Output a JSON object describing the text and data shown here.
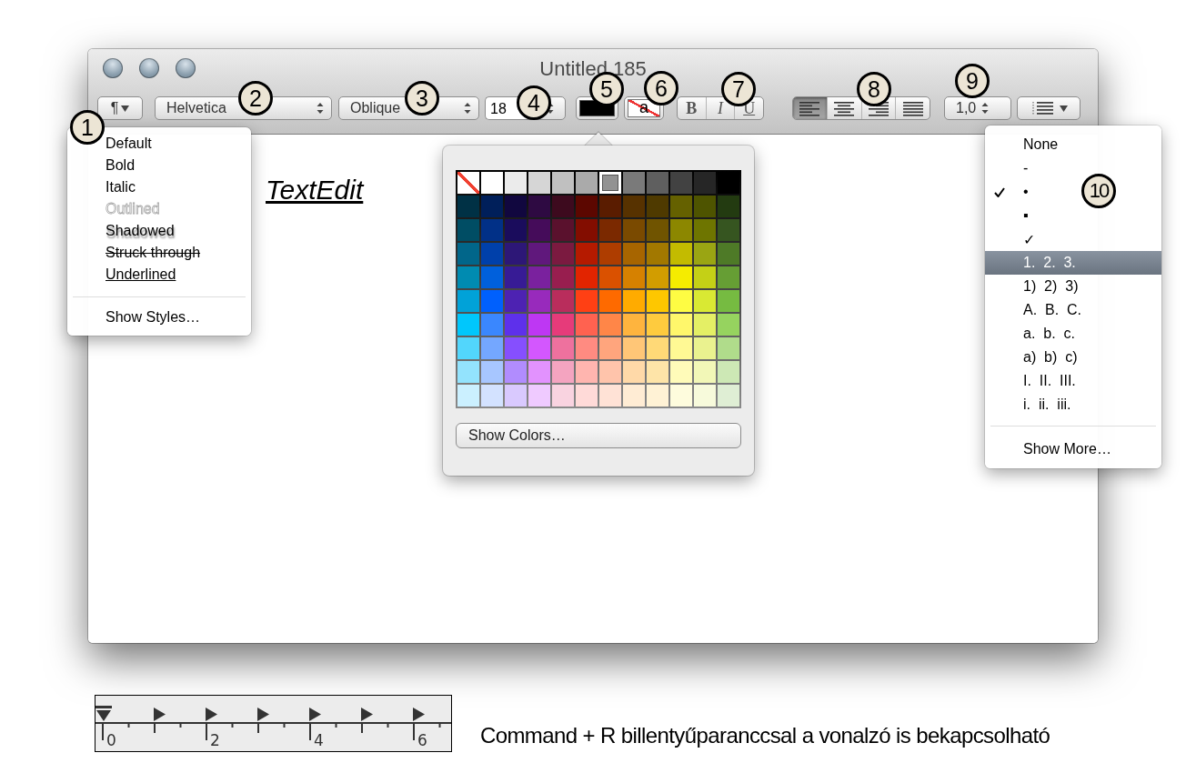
{
  "window": {
    "title": "Untitled 185"
  },
  "toolbar": {
    "paragraph_button": "¶",
    "font_family": "Helvetica",
    "typeface": "Oblique",
    "font_size": "18",
    "highlight_sample": "a",
    "style_buttons": [
      {
        "label": "B",
        "kind": "bold"
      },
      {
        "label": "I",
        "kind": "italic"
      },
      {
        "label": "U",
        "kind": "underline"
      }
    ],
    "alignment": [
      {
        "kind": "left",
        "selected": true
      },
      {
        "kind": "center",
        "selected": false
      },
      {
        "kind": "right",
        "selected": false
      },
      {
        "kind": "justify",
        "selected": false
      }
    ],
    "line_spacing": "1,0"
  },
  "document": {
    "text": "TextEdit"
  },
  "styles_menu": {
    "items": [
      {
        "label": "Default",
        "kind": "plain"
      },
      {
        "label": "Bold",
        "kind": "plain"
      },
      {
        "label": "Italic",
        "kind": "plain"
      },
      {
        "label": "Outlined",
        "kind": "outlined"
      },
      {
        "label": "Shadowed",
        "kind": "shadowed"
      },
      {
        "label": "Struck through",
        "kind": "strikethrough"
      },
      {
        "label": "Underlined",
        "kind": "underline"
      }
    ],
    "footer": "Show Styles…"
  },
  "color_popover": {
    "no_color_swatch": {
      "selected": false
    },
    "swatch_rows": [
      [
        {
          "color": "#ffffff",
          "selected": false
        },
        {
          "color": "#ebebeb",
          "selected": false
        },
        {
          "color": "#d6d6d6",
          "selected": false
        },
        {
          "color": "#c0c0c0",
          "selected": false
        },
        {
          "color": "#aaaaaa",
          "selected": false
        },
        {
          "color": "#929292",
          "selected": true
        },
        {
          "color": "#7a7a7a",
          "selected": false
        },
        {
          "color": "#5f5f5f",
          "selected": false
        },
        {
          "color": "#424242",
          "selected": false
        },
        {
          "color": "#262626",
          "selected": false
        },
        {
          "color": "#000000",
          "selected": false
        }
      ],
      [
        {
          "color": "#003145",
          "selected": false
        },
        {
          "color": "#001f5a",
          "selected": false
        },
        {
          "color": "#11073f",
          "selected": false
        },
        {
          "color": "#2e0a42",
          "selected": false
        },
        {
          "color": "#3d0a1e",
          "selected": false
        },
        {
          "color": "#5c0700",
          "selected": false
        },
        {
          "color": "#5a1c00",
          "selected": false
        },
        {
          "color": "#573200",
          "selected": false
        },
        {
          "color": "#4f3a00",
          "selected": false
        },
        {
          "color": "#656100",
          "selected": false
        },
        {
          "color": "#4e5400",
          "selected": false
        },
        {
          "color": "#233b11",
          "selected": false
        }
      ],
      [
        {
          "color": "#004d64",
          "selected": false
        },
        {
          "color": "#013087",
          "selected": false
        },
        {
          "color": "#1a0c5c",
          "selected": false
        },
        {
          "color": "#450c5a",
          "selected": false
        },
        {
          "color": "#5a112d",
          "selected": false
        },
        {
          "color": "#830d00",
          "selected": false
        },
        {
          "color": "#7b2900",
          "selected": false
        },
        {
          "color": "#7a4a00",
          "selected": false
        },
        {
          "color": "#705400",
          "selected": false
        },
        {
          "color": "#8c8700",
          "selected": false
        },
        {
          "color": "#6e7500",
          "selected": false
        },
        {
          "color": "#365520",
          "selected": false
        }
      ],
      [
        {
          "color": "#01668a",
          "selected": false
        },
        {
          "color": "#0040aa",
          "selected": false
        },
        {
          "color": "#2d1777",
          "selected": false
        },
        {
          "color": "#60187c",
          "selected": false
        },
        {
          "color": "#7b1a40",
          "selected": false
        },
        {
          "color": "#b51a00",
          "selected": false
        },
        {
          "color": "#ae3d00",
          "selected": false
        },
        {
          "color": "#a76500",
          "selected": false
        },
        {
          "color": "#a27800",
          "selected": false
        },
        {
          "color": "#c3bb00",
          "selected": false
        },
        {
          "color": "#9aa513",
          "selected": false
        },
        {
          "color": "#4e7a27",
          "selected": false
        }
      ],
      [
        {
          "color": "#008bb1",
          "selected": false
        },
        {
          "color": "#0060dc",
          "selected": false
        },
        {
          "color": "#371b95",
          "selected": false
        },
        {
          "color": "#7a219e",
          "selected": false
        },
        {
          "color": "#981e4f",
          "selected": false
        },
        {
          "color": "#e22400",
          "selected": false
        },
        {
          "color": "#da5100",
          "selected": false
        },
        {
          "color": "#d68100",
          "selected": false
        },
        {
          "color": "#d29d00",
          "selected": false
        },
        {
          "color": "#f5ec00",
          "selected": false
        },
        {
          "color": "#c4d016",
          "selected": false
        },
        {
          "color": "#669e34",
          "selected": false
        }
      ],
      [
        {
          "color": "#01a2d8",
          "selected": false
        },
        {
          "color": "#0060fd",
          "selected": false
        },
        {
          "color": "#4d22b2",
          "selected": false
        },
        {
          "color": "#982abc",
          "selected": false
        },
        {
          "color": "#b92d5c",
          "selected": false
        },
        {
          "color": "#ff4014",
          "selected": false
        },
        {
          "color": "#fe6a00",
          "selected": false
        },
        {
          "color": "#ffab00",
          "selected": false
        },
        {
          "color": "#fec700",
          "selected": false
        },
        {
          "color": "#fefc43",
          "selected": false
        },
        {
          "color": "#d9e933",
          "selected": false
        },
        {
          "color": "#76bb41",
          "selected": false
        }
      ],
      [
        {
          "color": "#00c7fc",
          "selected": false
        },
        {
          "color": "#3a87fe",
          "selected": false
        },
        {
          "color": "#5e30eb",
          "selected": false
        },
        {
          "color": "#be37f3",
          "selected": false
        },
        {
          "color": "#e63b7a",
          "selected": false
        },
        {
          "color": "#ff6250",
          "selected": false
        },
        {
          "color": "#ff8648",
          "selected": false
        },
        {
          "color": "#feb43e",
          "selected": false
        },
        {
          "color": "#fecb3e",
          "selected": false
        },
        {
          "color": "#fff76b",
          "selected": false
        },
        {
          "color": "#e4ef65",
          "selected": false
        },
        {
          "color": "#96d35f",
          "selected": false
        }
      ],
      [
        {
          "color": "#52d6fc",
          "selected": false
        },
        {
          "color": "#74a7ff",
          "selected": false
        },
        {
          "color": "#864ffe",
          "selected": false
        },
        {
          "color": "#d357fe",
          "selected": false
        },
        {
          "color": "#ee719e",
          "selected": false
        },
        {
          "color": "#ff8b81",
          "selected": false
        },
        {
          "color": "#ffa57d",
          "selected": false
        },
        {
          "color": "#ffc677",
          "selected": false
        },
        {
          "color": "#ffd977",
          "selected": false
        },
        {
          "color": "#fff994",
          "selected": false
        },
        {
          "color": "#eaf28f",
          "selected": false
        },
        {
          "color": "#b0dc8b",
          "selected": false
        }
      ],
      [
        {
          "color": "#93e3fd",
          "selected": false
        },
        {
          "color": "#a7c6ff",
          "selected": false
        },
        {
          "color": "#b18cfe",
          "selected": false
        },
        {
          "color": "#e292fe",
          "selected": false
        },
        {
          "color": "#f4a4c0",
          "selected": false
        },
        {
          "color": "#ffb5af",
          "selected": false
        },
        {
          "color": "#ffc4ab",
          "selected": false
        },
        {
          "color": "#ffd9a8",
          "selected": false
        },
        {
          "color": "#fee4a8",
          "selected": false
        },
        {
          "color": "#fffbb9",
          "selected": false
        },
        {
          "color": "#f2f7b7",
          "selected": false
        },
        {
          "color": "#cde8b5",
          "selected": false
        }
      ],
      [
        {
          "color": "#cbf0ff",
          "selected": false
        },
        {
          "color": "#d3e2ff",
          "selected": false
        },
        {
          "color": "#d9c9fe",
          "selected": false
        },
        {
          "color": "#efcaff",
          "selected": false
        },
        {
          "color": "#f9d3e0",
          "selected": false
        },
        {
          "color": "#ffdad8",
          "selected": false
        },
        {
          "color": "#ffe2d6",
          "selected": false
        },
        {
          "color": "#ffecd4",
          "selected": false
        },
        {
          "color": "#fff2d5",
          "selected": false
        },
        {
          "color": "#fefcdd",
          "selected": false
        },
        {
          "color": "#f7fadb",
          "selected": false
        },
        {
          "color": "#dfeed4",
          "selected": false
        }
      ]
    ],
    "button": "Show Colors…"
  },
  "list_menu": {
    "items": [
      {
        "label": "None",
        "checked": false,
        "selected": false
      },
      {
        "label": "-",
        "checked": false,
        "selected": false
      },
      {
        "label": "•",
        "checked": true,
        "selected": false
      },
      {
        "label": "▪",
        "checked": false,
        "selected": false
      },
      {
        "label": "✓",
        "checked": false,
        "selected": false
      },
      {
        "label": "1.  2.  3.",
        "checked": false,
        "selected": true
      },
      {
        "label": "1)  2)  3)",
        "checked": false,
        "selected": false
      },
      {
        "label": "A.  B.  C.",
        "checked": false,
        "selected": false
      },
      {
        "label": "a.  b.  c.",
        "checked": false,
        "selected": false
      },
      {
        "label": "a)  b)  c)",
        "checked": false,
        "selected": false
      },
      {
        "label": "I.  II.  III.",
        "checked": false,
        "selected": false
      },
      {
        "label": "i.  ii.  iii.",
        "checked": false,
        "selected": false
      }
    ],
    "footer": "Show More…"
  },
  "callouts": [
    "1",
    "2",
    "3",
    "4",
    "5",
    "6",
    "7",
    "8",
    "9",
    "10"
  ],
  "ruler": {
    "labels": [
      "0",
      "2",
      "4",
      "6"
    ]
  },
  "caption": "Command + R billentyűparanccsal a vonalzó is bekapcsolható"
}
